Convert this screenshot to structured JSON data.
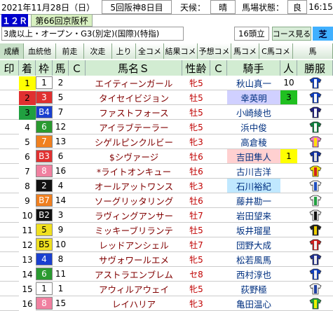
{
  "header": {
    "date": "2021年11月28日（日）",
    "meeting": "5回阪神8日目",
    "weather_label": "天候：",
    "weather": "晴",
    "track_label": "馬場状態：",
    "track": "良",
    "time": "16:15"
  },
  "race": {
    "number": "１２Ｒ",
    "title": "第66回京阪杯",
    "conditions": "3歳以上・オープン・G3(別定)(国際)(特指)",
    "runners": "16頭立",
    "course_label": "コース見る",
    "surface": "芝"
  },
  "tabs": [
    "成績",
    "血統他",
    "前走",
    "次走",
    "上り",
    "全コメ",
    "結果コメ",
    "予想コメ",
    "馬コメ",
    "C馬コメ",
    "馬"
  ],
  "columns": [
    "印",
    "着",
    "枠",
    "馬",
    "Ｃ",
    "馬名Ｓ",
    "性齢",
    "Ｃ",
    "騎手",
    "人",
    "勝服"
  ],
  "colors": {
    "header_bg": "#d2ecd2",
    "race_no_bg": "#0000cc",
    "title_bg": "#d8f0c0",
    "frame": [
      "#ffffff",
      "#ffffff",
      "#111111",
      "#e03030",
      "#1a40d0",
      "#f0e020",
      "#2a9a30",
      "#f08020",
      "#f080a0"
    ]
  },
  "rows": [
    {
      "finish": "1",
      "frame": "1",
      "num": "2",
      "name": "エイティーンガール",
      "sex": "牝5",
      "jockey": "秋山真一",
      "pop": "10",
      "finish_bg": "#ffff00",
      "frame_bg": "#ffffff",
      "frame_fg": "#000000",
      "jockey_bg": "#ffffff",
      "pop_bg": "#ffffff",
      "silk": [
        "#1040c0",
        "#ffffff"
      ]
    },
    {
      "finish": "2",
      "frame": "3",
      "num": "5",
      "name": "タイセイビジョン",
      "sex": "牡5",
      "jockey": "幸英明",
      "pop": "3",
      "finish_bg": "#e03030",
      "frame_bg": "#e03030",
      "frame_fg": "#ffffff",
      "jockey_bg": "#d0d0ff",
      "pop_bg": "#20c020",
      "silk": [
        "#1040c0",
        "#ffffff"
      ]
    },
    {
      "finish": "3",
      "frame": "B4",
      "num": "7",
      "name": "ファストフォース",
      "sex": "牡5",
      "jockey": "小崎綾也",
      "pop": "",
      "finish_bg": "#20a040",
      "frame_bg": "#1a40d0",
      "frame_fg": "#ffffff",
      "jockey_bg": "#ffffff",
      "pop_bg": "#ffffff",
      "silk": [
        "#202080",
        "#ffffff"
      ]
    },
    {
      "finish": "4",
      "frame": "6",
      "num": "12",
      "name": "アイラブテーラー",
      "sex": "牝5",
      "jockey": "浜中俊",
      "pop": "",
      "finish_bg": "#ffffff",
      "frame_bg": "#2a9a30",
      "frame_fg": "#ffffff",
      "jockey_bg": "#ffffff",
      "pop_bg": "#ffffff",
      "silk": [
        "#108040",
        "#ffffff"
      ]
    },
    {
      "finish": "5",
      "frame": "7",
      "num": "13",
      "name": "シゲルピンクルビー",
      "sex": "牝3",
      "jockey": "高倉稜",
      "pop": "",
      "finish_bg": "#ffffff",
      "frame_bg": "#f08020",
      "frame_fg": "#ffffff",
      "jockey_bg": "#ffffff",
      "pop_bg": "#ffffff",
      "silk": [
        "#f080c0",
        "#ffe000"
      ]
    },
    {
      "finish": "6",
      "frame": "B3",
      "num": "6",
      "name": "$シヴァージ",
      "sex": "牡6",
      "jockey": "吉田隼人",
      "pop": "1",
      "finish_bg": "#ffffff",
      "frame_bg": "#e03030",
      "frame_fg": "#ffffff",
      "jockey_bg": "#ffd0d0",
      "pop_bg": "#ffff00",
      "silk": [
        "#1030a0",
        "#e0e0e0"
      ]
    },
    {
      "finish": "7",
      "frame": "8",
      "num": "16",
      "name": "*ライトオンキュー",
      "sex": "牡6",
      "jockey": "古川吉洋",
      "pop": "",
      "finish_bg": "#ffffff",
      "frame_bg": "#f080a0",
      "frame_fg": "#ffffff",
      "jockey_bg": "#ffffff",
      "pop_bg": "#ffffff",
      "silk": [
        "#f0e000",
        "#d02020"
      ]
    },
    {
      "finish": "8",
      "frame": "2",
      "num": "4",
      "name": "オールアットワンス",
      "sex": "牝3",
      "jockey": "石川裕紀",
      "pop": "",
      "finish_bg": "#ffffff",
      "frame_bg": "#111111",
      "frame_fg": "#ffffff",
      "jockey_bg": "#c0e8ff",
      "pop_bg": "#ffffff",
      "silk": [
        "#f0f0f0",
        "#2050c0"
      ]
    },
    {
      "finish": "9",
      "frame": "B7",
      "num": "14",
      "name": "ソーグリッタリング",
      "sex": "牡6",
      "jockey": "藤井勘一",
      "pop": "",
      "finish_bg": "#ffffff",
      "frame_bg": "#f08020",
      "frame_fg": "#ffffff",
      "jockey_bg": "#ffffff",
      "pop_bg": "#ffffff",
      "silk": [
        "#f0f0f0",
        "#20a040"
      ]
    },
    {
      "finish": "10",
      "frame": "B2",
      "num": "3",
      "name": "ラヴィングアンサー",
      "sex": "牡7",
      "jockey": "岩田望来",
      "pop": "",
      "finish_bg": "#ffffff",
      "frame_bg": "#111111",
      "frame_fg": "#ffffff",
      "jockey_bg": "#ffffff",
      "pop_bg": "#ffffff",
      "silk": [
        "#e0e0e0",
        "#101010"
      ]
    },
    {
      "finish": "11",
      "frame": "5",
      "num": "9",
      "name": "ミッキーブリランテ",
      "sex": "牡5",
      "jockey": "坂井瑠星",
      "pop": "",
      "finish_bg": "#ffffff",
      "frame_bg": "#f0e020",
      "frame_fg": "#000000",
      "jockey_bg": "#ffffff",
      "pop_bg": "#ffffff",
      "silk": [
        "#202020",
        "#f0d000"
      ]
    },
    {
      "finish": "12",
      "frame": "B5",
      "num": "10",
      "name": "レッドアンシェル",
      "sex": "牡7",
      "jockey": "団野大成",
      "pop": "",
      "finish_bg": "#ffffff",
      "frame_bg": "#f0e020",
      "frame_fg": "#000000",
      "jockey_bg": "#ffffff",
      "pop_bg": "#ffffff",
      "silk": [
        "#d02020",
        "#f0f0f0"
      ]
    },
    {
      "finish": "13",
      "frame": "4",
      "num": "8",
      "name": "サヴォワールエメ",
      "sex": "牝5",
      "jockey": "松若風馬",
      "pop": "",
      "finish_bg": "#ffffff",
      "frame_bg": "#1a40d0",
      "frame_fg": "#ffffff",
      "jockey_bg": "#ffffff",
      "pop_bg": "#ffffff",
      "silk": [
        "#203090",
        "#f0f0f0"
      ]
    },
    {
      "finish": "14",
      "frame": "6",
      "num": "11",
      "name": "アストラエンブレム",
      "sex": "セ8",
      "jockey": "西村淳也",
      "pop": "",
      "finish_bg": "#ffffff",
      "frame_bg": "#2a9a30",
      "frame_fg": "#ffffff",
      "jockey_bg": "#ffffff",
      "pop_bg": "#ffffff",
      "silk": [
        "#1040c0",
        "#f0f0f0"
      ]
    },
    {
      "finish": "15",
      "frame": "1",
      "num": "1",
      "name": "アウィルアウェイ",
      "sex": "牝5",
      "jockey": "荻野極",
      "pop": "",
      "finish_bg": "#ffffff",
      "frame_bg": "#ffffff",
      "frame_fg": "#000000",
      "jockey_bg": "#ffffff",
      "pop_bg": "#ffffff",
      "silk": [
        "#f0f0f0",
        "#2040a0"
      ]
    },
    {
      "finish": "16",
      "frame": "8",
      "num": "15",
      "name": "レイハリア",
      "sex": "牝3",
      "jockey": "亀田温心",
      "pop": "",
      "finish_bg": "#ffffff",
      "frame_bg": "#f080a0",
      "frame_fg": "#ffffff",
      "jockey_bg": "#ffffff",
      "pop_bg": "#ffffff",
      "silk": [
        "#20a040",
        "#f0f000"
      ]
    }
  ]
}
